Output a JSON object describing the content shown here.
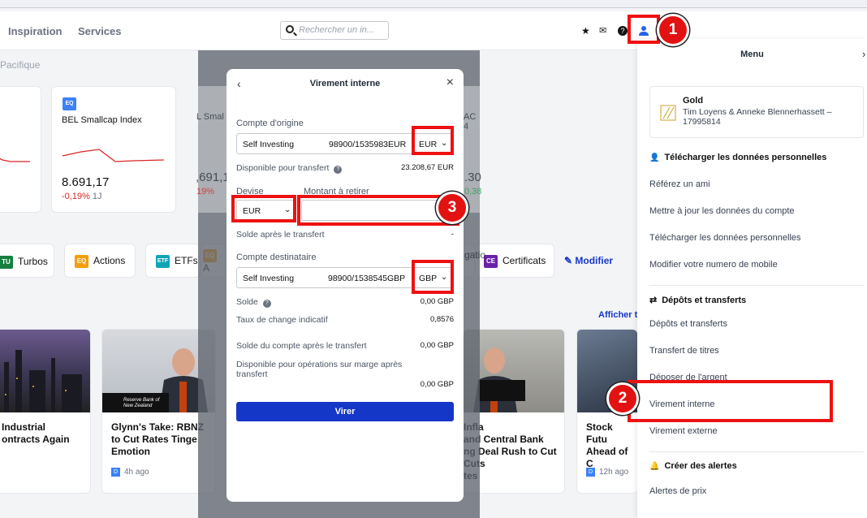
{
  "nav": {
    "inspiration": "Inspiration",
    "services": "Services"
  },
  "search": {
    "placeholder": "Rechercher un in..."
  },
  "subnav": {
    "region": "Pacifique"
  },
  "index_card": {
    "title": "BEL Smallcap Index",
    "value": "8.691,17",
    "change": "-0,19%",
    "period": "1J",
    "tag": "EQ"
  },
  "partial_cards": {
    "card3_title": "L Smal",
    "card3_value": ",691,1",
    "card3_change": "19%",
    "card4_title": "AC 4",
    "card4_value": ".30",
    "card4_change": "0,38"
  },
  "pills": [
    {
      "label": "Turbos",
      "tag": "TU",
      "color": "#15803d"
    },
    {
      "label": "Actions",
      "tag": "EQ",
      "color": "#f59e0b"
    },
    {
      "label": "ETFs",
      "tag": "ETF",
      "color": "#0ea5b7"
    },
    {
      "label": "Certificats",
      "tag": "CE",
      "color": "#6b21a8"
    }
  ],
  "pill_partial": {
    "eq_partial": "A",
    "tag_partial": "EQ",
    "certif_partial": "gatio"
  },
  "modify_link": "Modifier",
  "show_all_link": "Afficher t",
  "news": [
    {
      "title": "Industrial\nontracts Again",
      "time": ""
    },
    {
      "title": "Glynn's Take: RBNZ\nto Cut Rates Tinge\nEmotion",
      "time": "4h ago"
    },
    {
      "title": "Infla\nand Central Bank\nng Deal Rush to Cut\nCuts\ntes",
      "time": ""
    },
    {
      "title": "Stock Futu\nAhead of C",
      "time": "12h ago"
    }
  ],
  "news_tag": "D",
  "rbnz_caption": "Reserve Bank of New Zealand",
  "modal": {
    "title": "Virement interne",
    "origin_label": "Compte d'origine",
    "origin_name": "Self Investing",
    "origin_number": "98900/1535983EUR",
    "origin_currency": "EUR",
    "available_label": "Disponible pour transfert",
    "available_value": "23.208,67 EUR",
    "currency_label": "Devise",
    "amount_label": "Montant à retirer",
    "currency_value": "EUR",
    "balance_after_label": "Solde après le transfert",
    "balance_after_value": "-",
    "dest_label": "Compte destinataire",
    "dest_name": "Self Investing",
    "dest_number": "98900/1538545GBP",
    "dest_currency": "GBP",
    "solde_label": "Solde",
    "solde_value": "0,00 GBP",
    "rate_label": "Taux de change indicatif",
    "rate_value": "0,8576",
    "acct_after_label": "Solde du compte après le transfert",
    "acct_after_value": "0,00 GBP",
    "margin_label": "Disponible pour opérations sur marge après transfert",
    "margin_value": "0,00 GBP",
    "submit": "Virer"
  },
  "menu": {
    "title": "Menu",
    "account_level": "Gold",
    "account_holders": "Tim Loyens & Anneke Blennerhassett –",
    "account_number": "17995814",
    "section_personal": "Télécharger les données personnelles",
    "refer": "Référez un ami",
    "update": "Mettre à jour les données du compte",
    "download": "Télécharger les données personnelles",
    "mobile": "Modifier votre numero de mobile",
    "section_deposits": "Dépôts et transferts",
    "deposits": "Dépôts et transferts",
    "securities": "Transfert de titres",
    "deposit_money": "Déposer de l'argent",
    "internal": "Virement interne",
    "external": "Virement externe",
    "section_alerts": "Créer des alertes",
    "price_alerts": "Alertes de prix"
  },
  "badges": [
    "1",
    "2",
    "3"
  ],
  "colors": {
    "accent": "#1437c8",
    "annotation": "#ee1111",
    "negative": "#dc2626",
    "positive": "#16a34a"
  }
}
